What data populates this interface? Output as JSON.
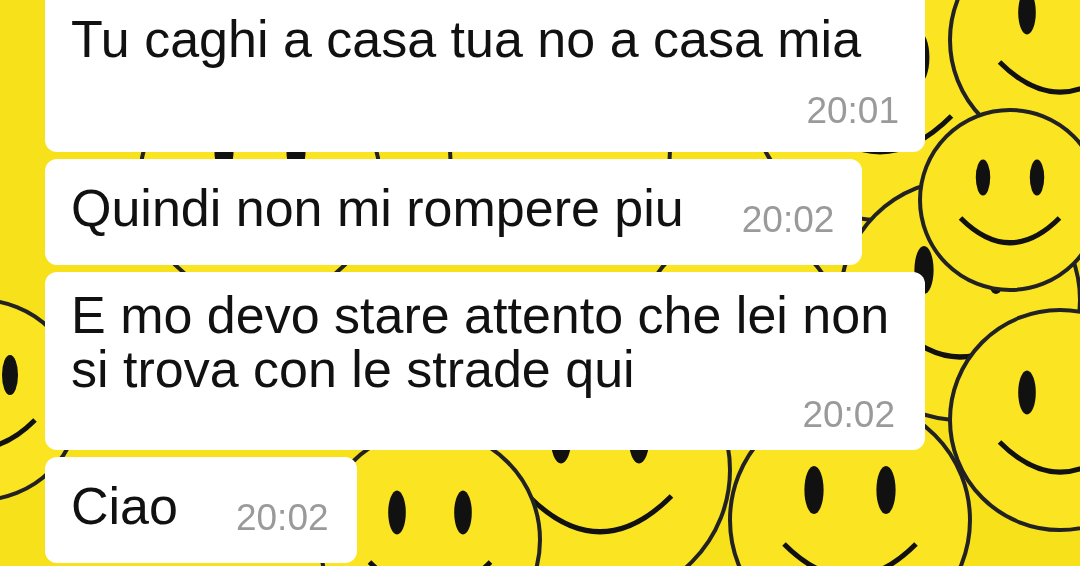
{
  "messages": [
    {
      "kind": "time_below",
      "text": "Tu caghi a casa tua no a casa mia",
      "time": "20:01"
    },
    {
      "kind": "time_inline",
      "text": "Quindi non mi rompere piu",
      "time": "20:02"
    },
    {
      "kind": "time_corner",
      "text": "E mo devo stare attento che lei non si trova con le strade qui",
      "time": "20:02"
    },
    {
      "kind": "time_inline",
      "text": "Ciao",
      "time": "20:02"
    }
  ]
}
